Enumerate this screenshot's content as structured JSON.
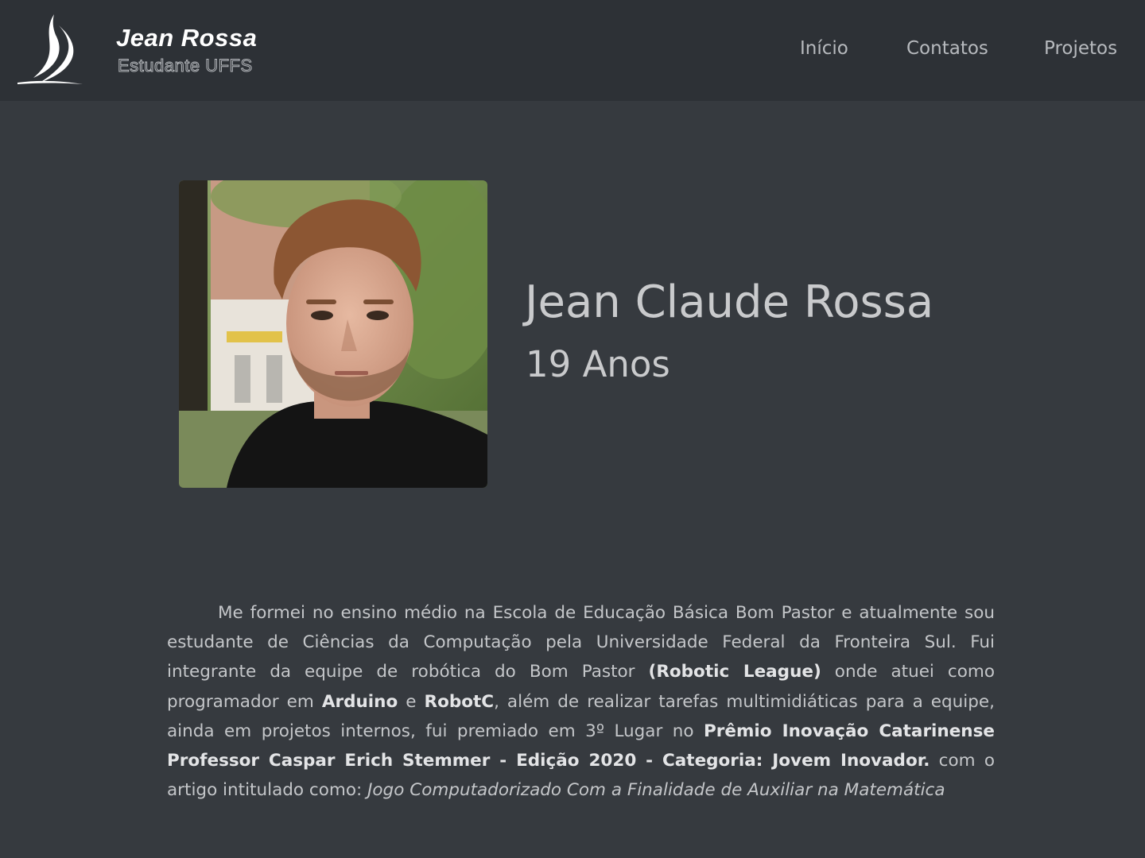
{
  "header": {
    "brand_name": "Jean Rossa",
    "brand_subtitle": "Estudante UFFS",
    "logo_icon": "uffs-sail-logo",
    "nav": [
      {
        "label": "Início"
      },
      {
        "label": "Contatos"
      },
      {
        "label": "Projetos"
      }
    ]
  },
  "profile": {
    "photo": "profile-photo",
    "name": "Jean Claude Rossa",
    "age": "19 Anos"
  },
  "bio": {
    "t1": "Me formei no ensino médio na Escola de Educação Básica Bom Pastor e atualmente sou estudante de Ciências da Computação pela Universidade Federal da Fronteira Sul. Fui integrante da equipe de robótica do Bom Pastor ",
    "b1": "(Robotic League)",
    "t2": " onde atuei como programador em ",
    "b2": "Arduino",
    "t3": " e ",
    "b3": "RobotC",
    "t4": ", além de realizar tarefas multimidiáticas para a equipe, ainda em projetos internos, fui premiado em 3º Lugar no ",
    "b4": "Prêmio Inovação Catarinense Professor Caspar Erich Stemmer - Edição 2020 - Categoria: Jovem Inovador.",
    "t5": " com o artigo intitulado como: ",
    "i1": "Jogo Computadorizado Com a Finalidade de Auxiliar na Matemática"
  },
  "colors": {
    "background": "#363a3f",
    "navbar": "#2d3136",
    "text": "#c4c6c9"
  }
}
